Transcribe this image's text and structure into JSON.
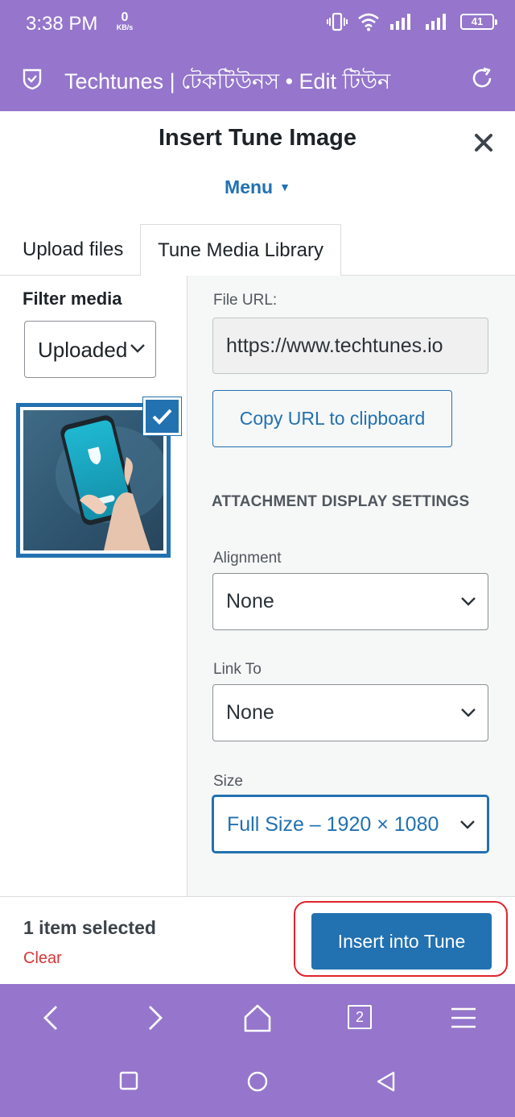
{
  "status_bar": {
    "time": "3:38 PM",
    "net_speed_value": "0",
    "net_speed_unit": "KB/s",
    "battery": "41"
  },
  "browser": {
    "title": "Techtunes | টেকটিউনস • Edit টিউন"
  },
  "modal": {
    "title": "Insert Tune Image",
    "menu_label": "Menu",
    "tabs": [
      "Upload files",
      "Tune Media Library"
    ],
    "filter": {
      "label": "Filter media",
      "selected": "Uploaded"
    },
    "attachment": {
      "file_url_label": "File URL:",
      "file_url_value": "https://www.techtunes.io",
      "copy_button": "Copy URL to clipboard",
      "section_heading": "ATTACHMENT DISPLAY SETTINGS",
      "alignment_label": "Alignment",
      "alignment_value": "None",
      "link_to_label": "Link To",
      "link_to_value": "None",
      "size_label": "Size",
      "size_value": "Full Size – 1920 × 1080"
    },
    "footer": {
      "selection_count": "1 item selected",
      "clear_label": "Clear",
      "insert_button": "Insert into Tune"
    }
  },
  "bottom_nav": {
    "tab_count": "2"
  },
  "colors": {
    "chrome_purple": "#9576cc",
    "wp_blue": "#2271b1",
    "clear_red": "#d63638",
    "highlight_red": "#e0232d"
  }
}
